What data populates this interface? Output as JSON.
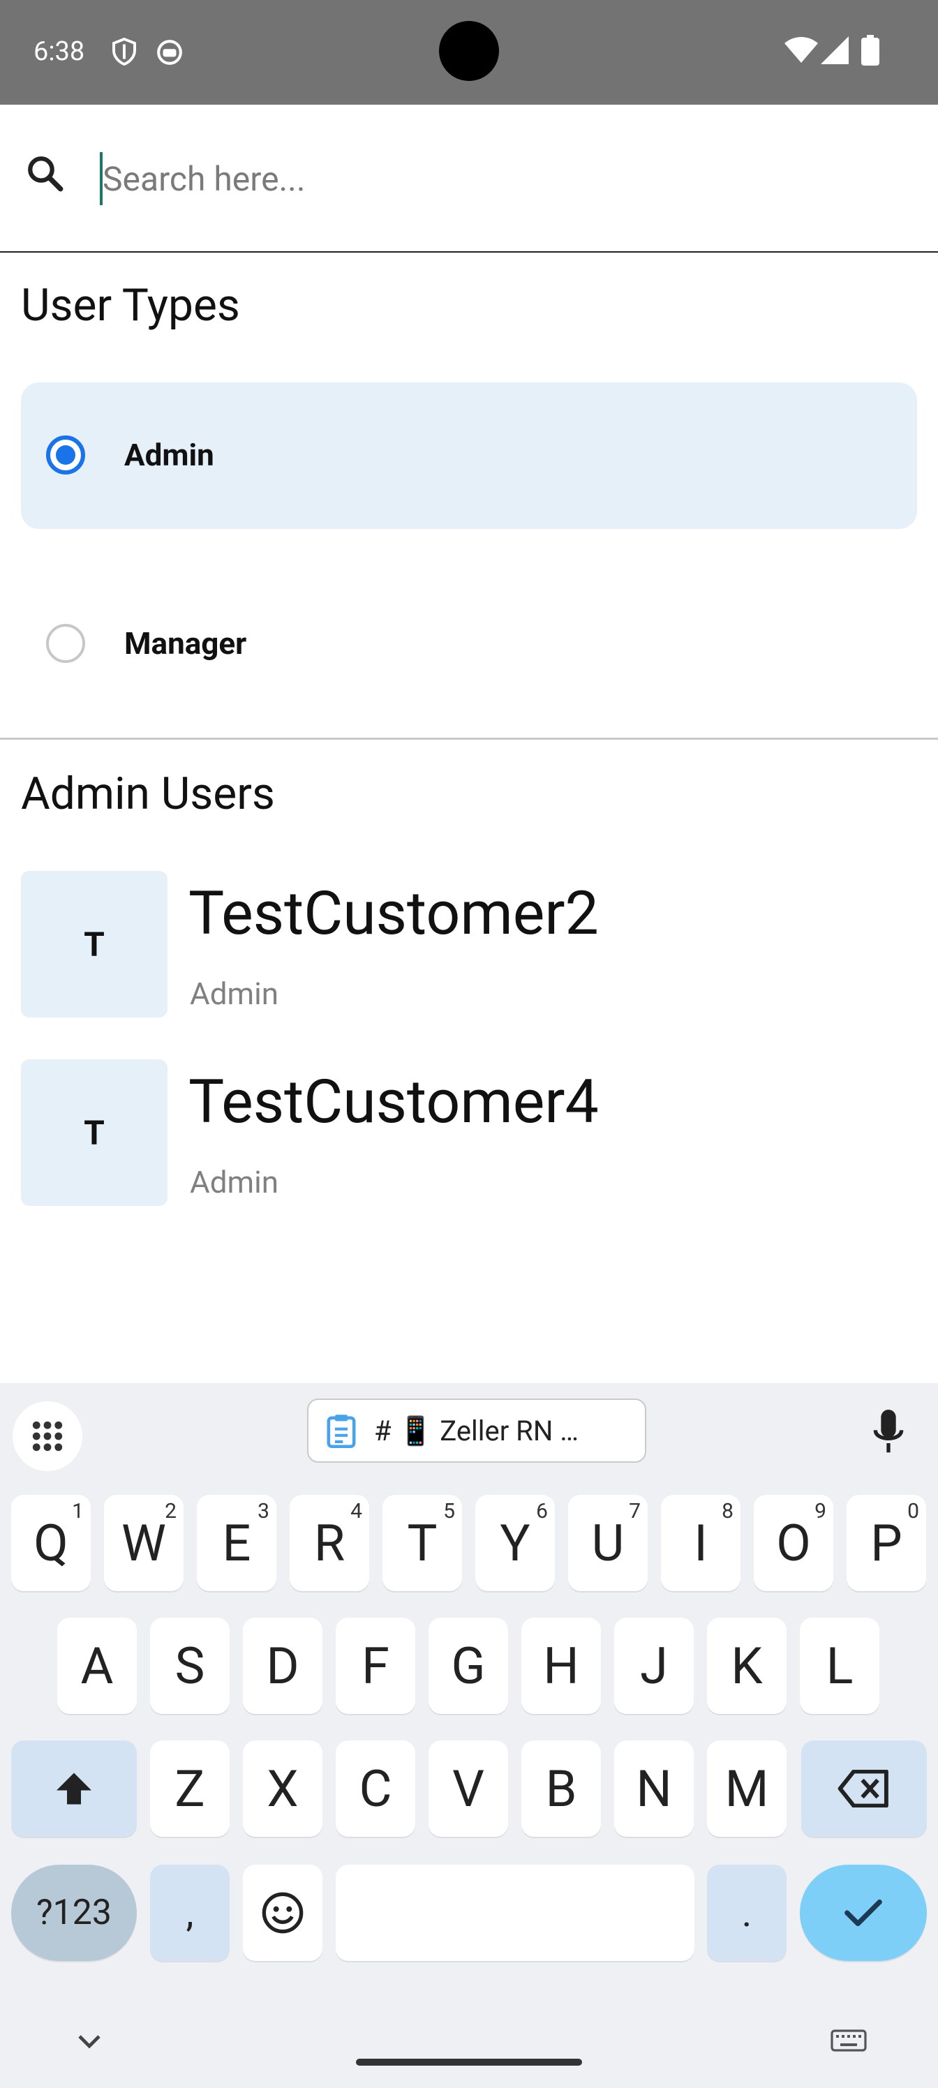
{
  "status_bar": {
    "time": "6:38"
  },
  "search": {
    "placeholder": "Search here...",
    "value": ""
  },
  "user_types": {
    "title": "User Types",
    "options": [
      {
        "label": "Admin",
        "selected": true
      },
      {
        "label": "Manager",
        "selected": false
      }
    ]
  },
  "admin_users": {
    "title": "Admin Users",
    "users": [
      {
        "initial": "T",
        "name": "TestCustomer2",
        "role": "Admin"
      },
      {
        "initial": "T",
        "name": "TestCustomer4",
        "role": "Admin"
      }
    ]
  },
  "keyboard": {
    "clipboard_chip": "# 📱 Zeller RN …",
    "row1": [
      {
        "k": "Q",
        "h": "1"
      },
      {
        "k": "W",
        "h": "2"
      },
      {
        "k": "E",
        "h": "3"
      },
      {
        "k": "R",
        "h": "4"
      },
      {
        "k": "T",
        "h": "5"
      },
      {
        "k": "Y",
        "h": "6"
      },
      {
        "k": "U",
        "h": "7"
      },
      {
        "k": "I",
        "h": "8"
      },
      {
        "k": "O",
        "h": "9"
      },
      {
        "k": "P",
        "h": "0"
      }
    ],
    "row2": [
      "A",
      "S",
      "D",
      "F",
      "G",
      "H",
      "J",
      "K",
      "L"
    ],
    "row3": [
      "Z",
      "X",
      "C",
      "V",
      "B",
      "N",
      "M"
    ],
    "symbols_key": "?123",
    "comma_key": ",",
    "period_key": "."
  },
  "colors": {
    "accent": "#1a73e8",
    "selected_bg": "#e5f0f9",
    "avatar_bg": "#e6f0f9",
    "keyboard_bg": "#eef0f4",
    "enter_key": "#7ecff7"
  }
}
